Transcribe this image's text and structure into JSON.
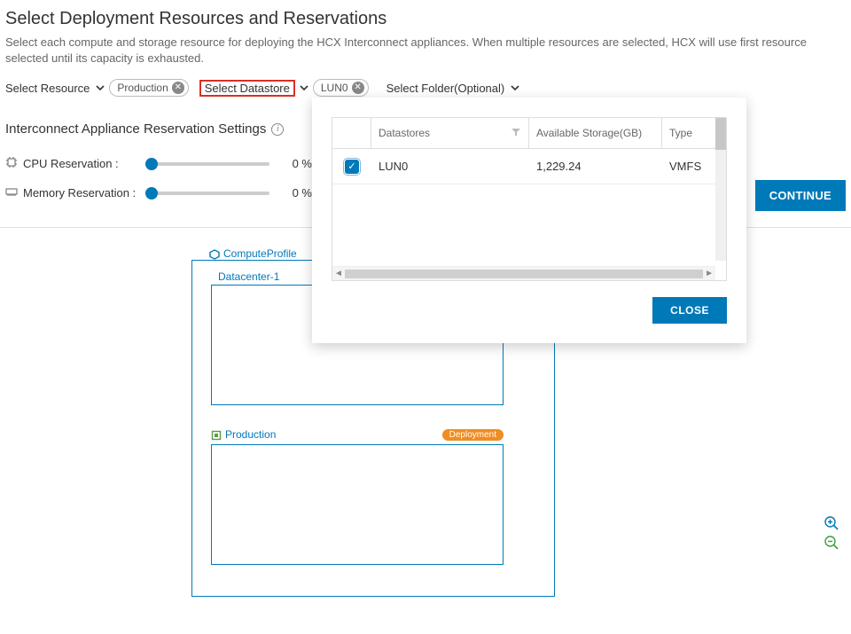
{
  "page": {
    "title": "Select Deployment Resources and Reservations",
    "description": "Select each compute and storage resource for deploying the HCX Interconnect appliances. When multiple resources are selected, HCX will use first resource selected until its capacity is exhausted."
  },
  "selectors": {
    "resource_label": "Select Resource",
    "resource_chip": "Production",
    "datastore_label": "Select Datastore",
    "datastore_chip": "LUN0",
    "folder_label": "Select Folder(Optional)"
  },
  "settings": {
    "title": "Interconnect Appliance Reservation Settings",
    "cpu_label": "CPU Reservation :",
    "cpu_value": "0 %",
    "memory_label": "Memory Reservation :",
    "memory_value": "0 %"
  },
  "buttons": {
    "continue": "CONTINUE",
    "close": "CLOSE"
  },
  "diagram": {
    "compute_profile": "ComputeProfile",
    "datacenter": "Datacenter-1",
    "production": "Production",
    "deployment_pill": "Deployment"
  },
  "dropdown": {
    "col_datastores": "Datastores",
    "col_available": "Available Storage(GB)",
    "col_type": "Type",
    "rows": [
      {
        "checked": true,
        "name": "LUN0",
        "available": "1,229.24",
        "type": "VMFS"
      }
    ]
  }
}
